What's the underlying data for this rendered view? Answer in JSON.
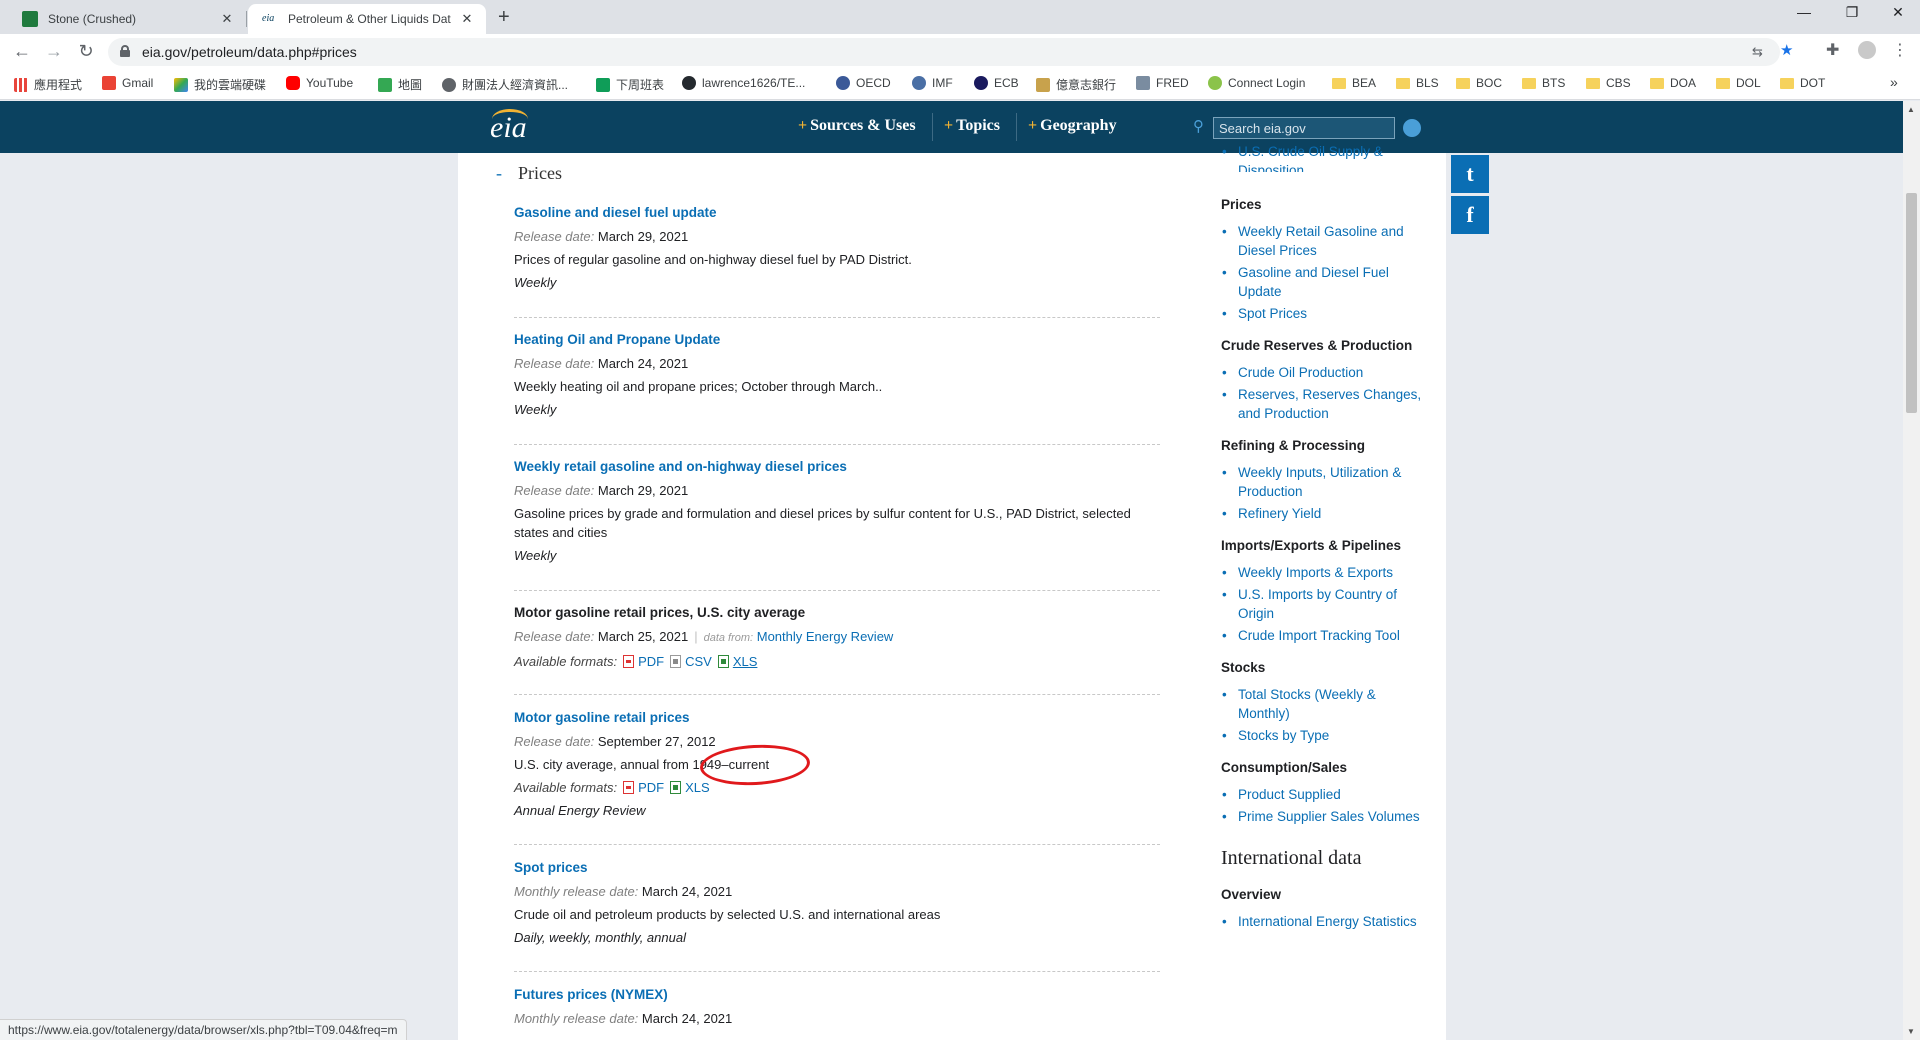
{
  "browser": {
    "tabs": [
      {
        "title": "Stone (Crushed)",
        "active": false
      },
      {
        "title": "Petroleum & Other Liquids Dat",
        "active": true
      }
    ],
    "url": "eia.gov/petroleum/data.php#prices",
    "bookmarks": [
      "應用程式",
      "Gmail",
      "我的雲端硬碟",
      "YouTube",
      "地圖",
      "財團法人經濟資訊...",
      "下周班表",
      "lawrence1626/TE...",
      "OECD",
      "IMF",
      "ECB",
      "億意志銀行",
      "FRED",
      "Connect Login",
      "BEA",
      "BLS",
      "BOC",
      "BTS",
      "CBS",
      "DOA",
      "DOL",
      "DOT"
    ],
    "more_bookmarks": "»",
    "status_url": "https://www.eia.gov/totalenergy/data/browser/xls.php?tbl=T09.04&freq=m"
  },
  "header": {
    "logo": "eia",
    "nav": [
      "Sources & Uses",
      "Topics",
      "Geography"
    ],
    "search_placeholder": "Search eia.gov"
  },
  "section": {
    "toggle": "-",
    "title": "Prices"
  },
  "entries": [
    {
      "title": "Gasoline and diesel fuel update",
      "release_label": "Release date:",
      "release_date": "March 29, 2021",
      "description": "Prices of regular gasoline and on-highway diesel fuel by PAD District.",
      "frequency": "Weekly"
    },
    {
      "title": "Heating Oil and Propane Update",
      "release_label": "Release date:",
      "release_date": "March 24, 2021",
      "description": "Weekly heating oil and propane prices; October through March..",
      "frequency": "Weekly"
    },
    {
      "title": "Weekly retail gasoline and on-highway diesel prices",
      "release_label": "Release date:",
      "release_date": "March 29, 2021",
      "description": "Gasoline prices by grade and formulation and diesel prices by sulfur content for U.S., PAD District, selected states and cities",
      "frequency": "Weekly"
    },
    {
      "title": "Motor gasoline retail prices, U.S. city average",
      "release_label": "Release date:",
      "release_date": "March 25, 2021",
      "data_from_label": "data from:",
      "data_from": "Monthly Energy Review",
      "formats_label": "Available formats:",
      "formats": [
        "PDF",
        "CSV",
        "XLS"
      ]
    },
    {
      "title": "Motor gasoline retail prices",
      "release_label": "Release date:",
      "release_date": "September 27, 2012",
      "description": "U.S. city average, annual from 1949–current",
      "formats_label": "Available formats:",
      "formats": [
        "PDF",
        "XLS"
      ],
      "source": "Annual Energy Review"
    },
    {
      "title": "Spot prices",
      "release_label": "Monthly release date:",
      "release_date": "March 24, 2021",
      "description": "Crude oil and petroleum products by selected U.S. and international areas",
      "frequency": "Daily, weekly, monthly, annual"
    },
    {
      "title": "Futures prices (NYMEX)",
      "release_label": "Monthly release date:",
      "release_date": "March 24, 2021"
    }
  ],
  "sidebar": {
    "top_item": "U.S. Crude Oil Supply & Disposition",
    "groups": [
      {
        "heading": "Prices",
        "items": [
          "Weekly Retail Gasoline and Diesel Prices",
          "Gasoline and Diesel Fuel Update",
          "Spot Prices"
        ]
      },
      {
        "heading": "Crude Reserves & Production",
        "items": [
          "Crude Oil Production",
          "Reserves, Reserves Changes, and Production"
        ]
      },
      {
        "heading": "Refining & Processing",
        "items": [
          "Weekly Inputs, Utilization & Production",
          "Refinery Yield"
        ]
      },
      {
        "heading": "Imports/Exports & Pipelines",
        "items": [
          "Weekly Imports & Exports",
          "U.S. Imports by Country of Origin",
          "Crude Import Tracking Tool"
        ]
      },
      {
        "heading": "Stocks",
        "items": [
          "Total Stocks (Weekly & Monthly)",
          "Stocks by Type"
        ]
      },
      {
        "heading": "Consumption/Sales",
        "items": [
          "Product Supplied",
          "Prime Supplier Sales Volumes"
        ]
      }
    ],
    "international_title": "International data",
    "overview_heading": "Overview",
    "overview_items": [
      "International Energy Statistics"
    ]
  },
  "social": {
    "twitter": "t",
    "facebook": "f"
  },
  "colors": {
    "header_bg": "#0b4260",
    "link": "#0a6eb4",
    "accent": "#f0b233",
    "annotation": "#e0191c"
  }
}
